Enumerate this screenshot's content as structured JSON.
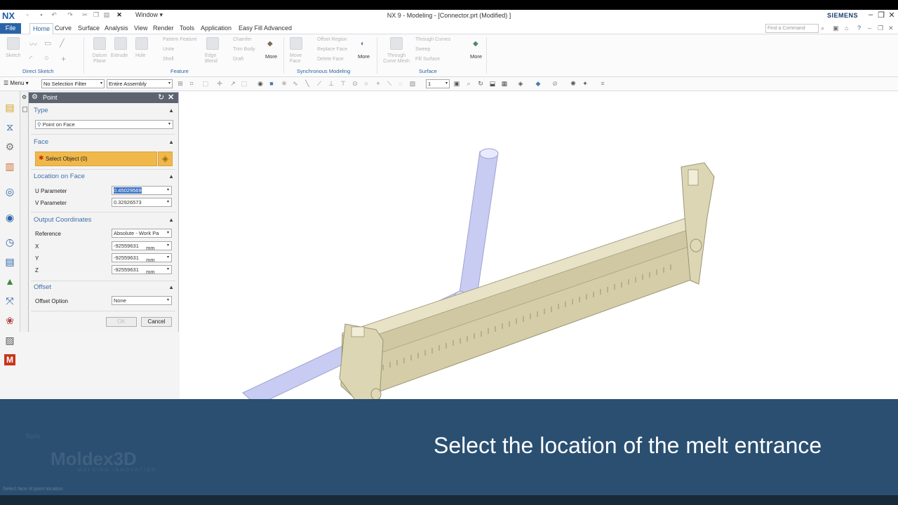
{
  "app": {
    "logo": "NX",
    "window_menu": "Window",
    "title": "NX 9 - Modeling - [Connector.prt (Modified) ]",
    "brand": "SIEMENS",
    "find_placeholder": "Find a Command"
  },
  "menu_tabs": [
    "File",
    "Home",
    "Curve",
    "Surface",
    "Analysis",
    "View",
    "Render",
    "Tools",
    "Application",
    "Easy Fill Advanced"
  ],
  "ribbon": {
    "groups": {
      "direct_sketch": "Direct Sketch",
      "feature": "Feature",
      "synchronous": "Synchronous Modeling",
      "surface": "Surface"
    },
    "items": {
      "sketch": "Sketch",
      "datum_plane": "Datum Plane",
      "extrude": "Extrude",
      "hole": "Hole",
      "pattern_feature": "Pattern Feature",
      "unite": "Unite",
      "shell": "Shell",
      "edge_blend": "Edge Blend",
      "chamfer": "Chamfer",
      "trim_body": "Trim Body",
      "draft": "Draft",
      "more": "More",
      "move_face": "Move Face",
      "offset_region": "Offset Region",
      "replace_face": "Replace Face",
      "delete_face": "Delete Face",
      "through_curve_mesh": "Through Curve Mesh",
      "through_curves": "Through Curves",
      "sweep": "Sweep",
      "fill_surface": "Fill Surface"
    }
  },
  "selection_bar": {
    "menu": "Menu",
    "filter": "No Selection Filter",
    "scope": "Entire Assembly",
    "layer": "1"
  },
  "dialog": {
    "title": "Point",
    "type_section": "Type",
    "type_value": "Point on Face",
    "face_section": "Face",
    "select_object": "Select Object (0)",
    "location_section": "Location on Face",
    "u_label": "U Parameter",
    "u_value": "0.45029569",
    "v_label": "V Parameter",
    "v_value": "0.32926573",
    "output_section": "Output Coordinates",
    "reference_label": "Reference",
    "reference_value": "Absolute - Work Pa",
    "x_label": "X",
    "y_label": "Y",
    "z_label": "Z",
    "coord_value": "-92559631",
    "unit": "mm",
    "offset_section": "Offset",
    "offset_label": "Offset Option",
    "offset_value": "None",
    "ok": "OK",
    "cancel": "Cancel"
  },
  "overlay": {
    "caption": "Select the location of the melt entrance",
    "tools_label": "Tools",
    "watermark": "Moldex3D",
    "watermark_sub": "MOLDING INNOVATION"
  },
  "status": "Select face of point location",
  "colors": {
    "accent": "#2a64a8",
    "selection_highlight": "#f0b84a",
    "overlay": "#1d4468",
    "part_body": "#ddd6b4",
    "runner": "#c8ccf2"
  }
}
